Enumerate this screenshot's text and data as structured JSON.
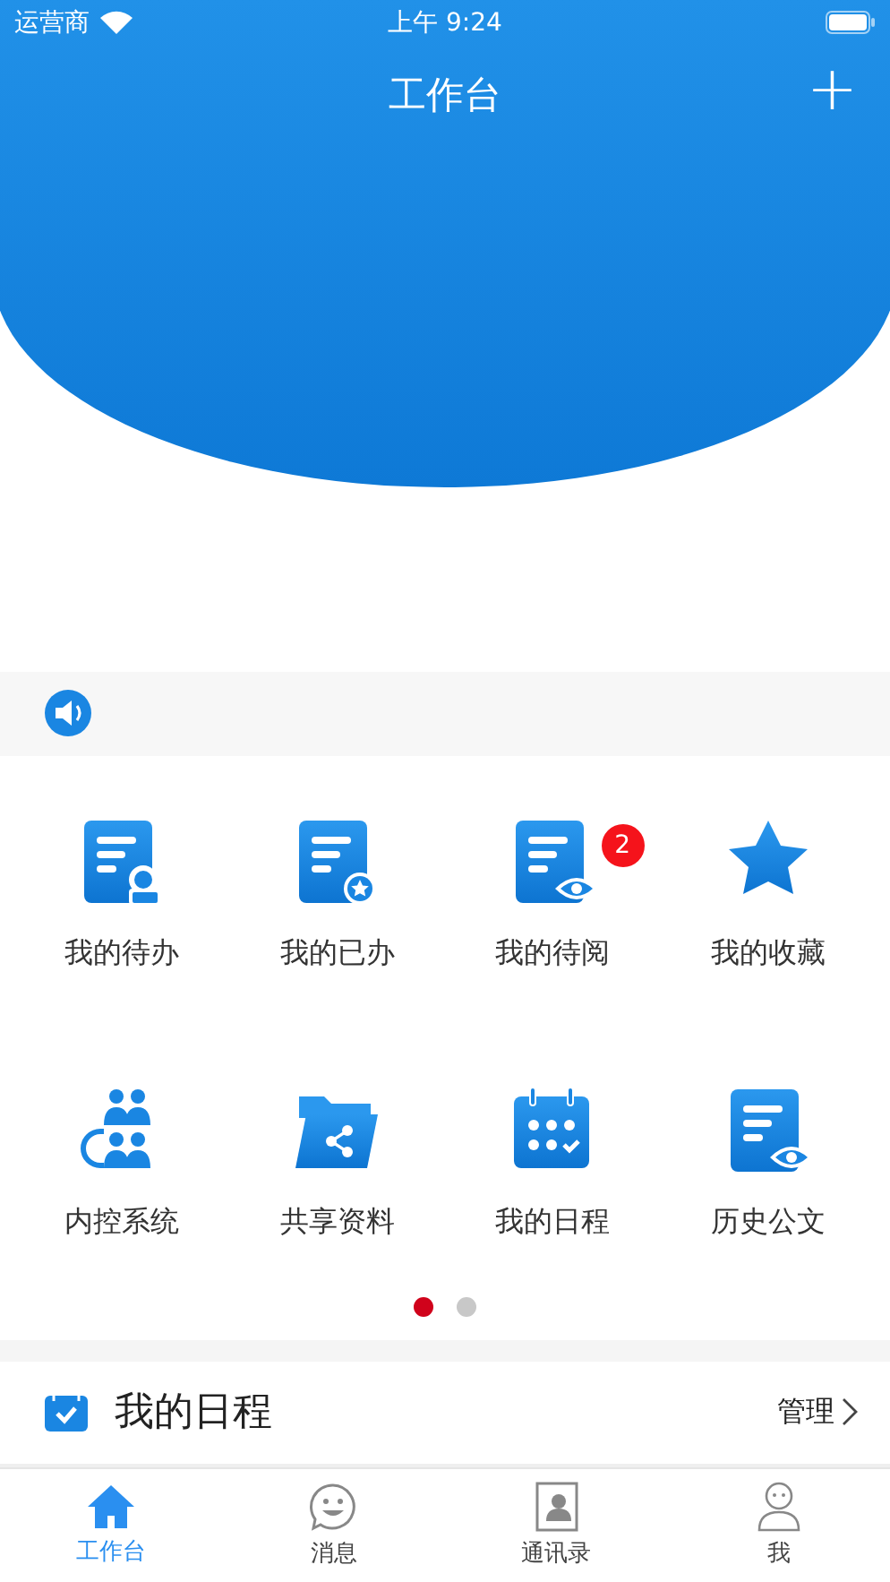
{
  "status_bar": {
    "carrier": "运营商",
    "time": "上午 9:24"
  },
  "nav_bar": {
    "title": "工作台",
    "action": "+"
  },
  "apps": [
    {
      "label": "我的待办"
    },
    {
      "label": "我的已办"
    },
    {
      "label": "我的待阅",
      "badge": "2"
    },
    {
      "label": "我的收藏"
    },
    {
      "label": "内控系统"
    },
    {
      "label": "共享资料"
    },
    {
      "label": "我的日程"
    },
    {
      "label": "历史公文"
    }
  ],
  "pager": [
    {
      "selected": true
    },
    {
      "selected": false
    }
  ],
  "schedule": {
    "title": "我的日程",
    "action": "管理"
  },
  "tab_bar": [
    {
      "label": "工作台",
      "selected": true
    },
    {
      "label": "消息",
      "selected": false
    },
    {
      "label": "通讯录",
      "selected": false
    },
    {
      "label": "我",
      "selected": false
    }
  ]
}
